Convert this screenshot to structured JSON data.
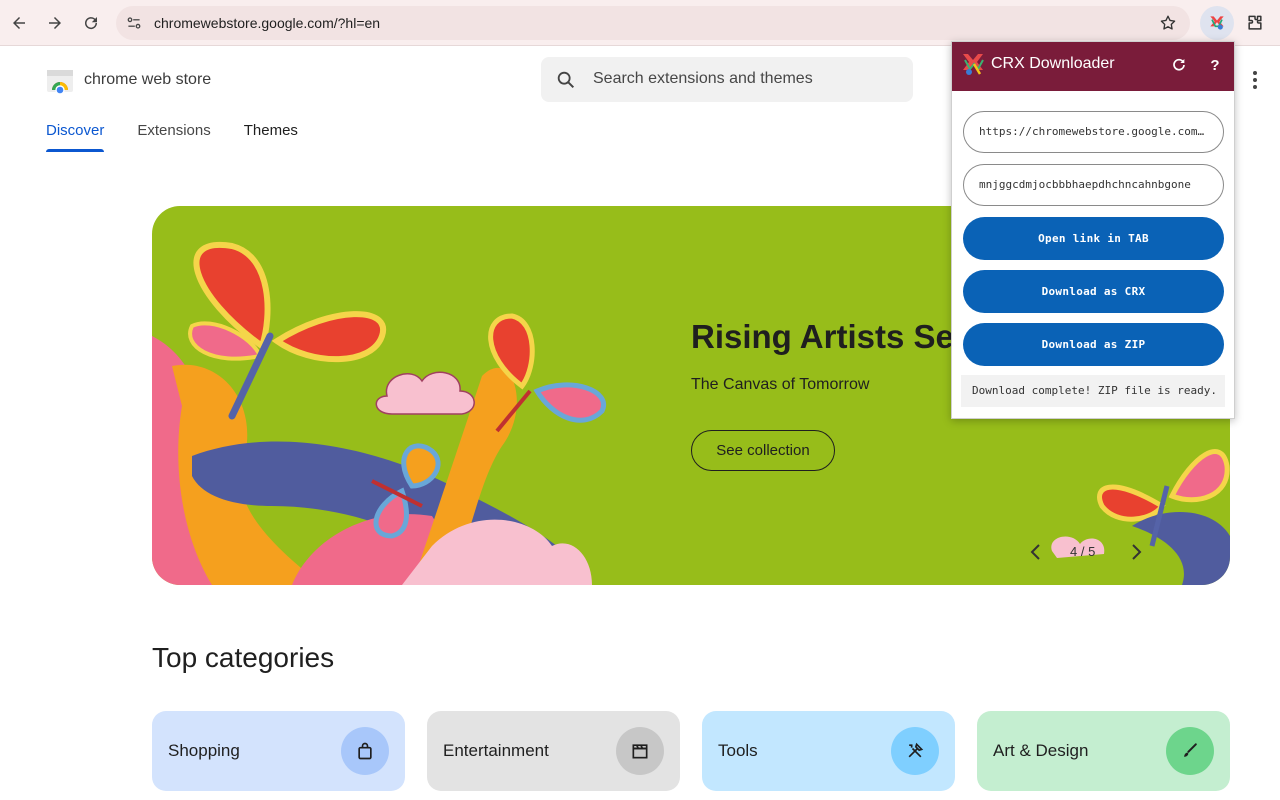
{
  "browser": {
    "url": "chromewebstore.google.com/?hl=en",
    "icons": [
      "back-arrow-icon",
      "forward-arrow-icon",
      "reload-icon",
      "site-info-icon",
      "bookmark-star-icon",
      "crx-extension-icon",
      "extensions-puzzle-icon"
    ]
  },
  "store": {
    "name": "chrome web store",
    "search_placeholder": "Search extensions and themes",
    "tabs": [
      {
        "label": "Discover",
        "active": true
      },
      {
        "label": "Extensions",
        "active": false
      },
      {
        "label": "Themes",
        "active": false
      }
    ]
  },
  "hero": {
    "title": "Rising Artists Ser",
    "subtitle": "The Canvas of Tomorrow",
    "button": "See collection",
    "pager": "4 / 5",
    "background": "#97bd1a"
  },
  "categories": {
    "title": "Top categories",
    "items": [
      {
        "label": "Shopping",
        "icon": "shopping-bag-icon",
        "bg": "#d3e3fd",
        "icon_bg": "#a8c7fa"
      },
      {
        "label": "Entertainment",
        "icon": "clapperboard-icon",
        "bg": "#e3e3e3",
        "icon_bg": "#c7c7c7"
      },
      {
        "label": "Tools",
        "icon": "tools-icon",
        "bg": "#c2e7ff",
        "icon_bg": "#7fcfff"
      },
      {
        "label": "Art & Design",
        "icon": "brush-icon",
        "bg": "#c4eed0",
        "icon_bg": "#6dd58c"
      }
    ]
  },
  "popup": {
    "title": "CRX Downloader",
    "header_color": "#7a1c3a",
    "url_field": "https://chromewebstore.google.com/?hl=en",
    "id_field": "mnjggcdmjocbbbhaepdhchncahnbgone",
    "open_tab": "Open link in TAB",
    "download_crx": "Download as CRX",
    "download_zip": "Download as ZIP",
    "status": "Download complete! ZIP file is ready.",
    "help": "?",
    "button_color": "#0a62b6"
  }
}
